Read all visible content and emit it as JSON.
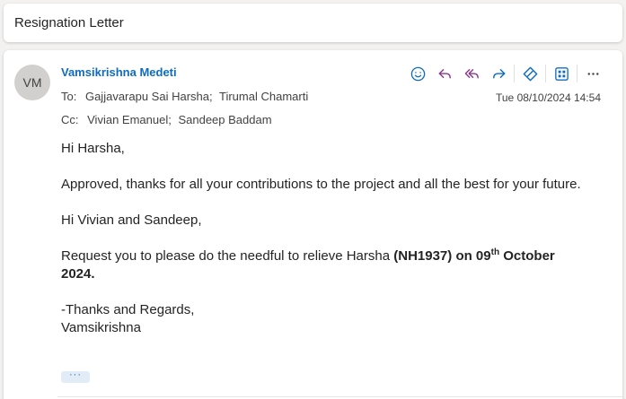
{
  "subject": "Resignation Letter",
  "message": {
    "avatar_initials": "VM",
    "sender": "Vamsikrishna Medeti",
    "to_label": "To:",
    "to": [
      "Gajjavarapu Sai Harsha;",
      "Tirumal Chamarti"
    ],
    "cc_label": "Cc:",
    "cc": [
      "Vivian Emanuel;",
      "Sandeep Baddam"
    ],
    "date": "Tue 08/10/2024 14:54",
    "body": {
      "greeting": "Hi Harsha,",
      "para1": "Approved, thanks for all your contributions to the project and all the best for your future.",
      "greeting2": "Hi Vivian and Sandeep,",
      "para3_prefix": "Request you to please do the needful to relieve Harsha ",
      "para3_bold_a": "(NH1937) on 09",
      "para3_sup": "th",
      "para3_bold_b": " October 2024.",
      "closing": "-Thanks and Regards,",
      "signature": "Vamsikrishna"
    },
    "more_label": "···"
  },
  "toolbar": {
    "icons": [
      "emoji-icon",
      "reply-icon",
      "reply-all-icon",
      "forward-icon",
      "copilot-icon",
      "apps-icon",
      "more-icon"
    ]
  },
  "colors": {
    "accent": "#0f6cbd",
    "background": "#f3f2f1"
  }
}
